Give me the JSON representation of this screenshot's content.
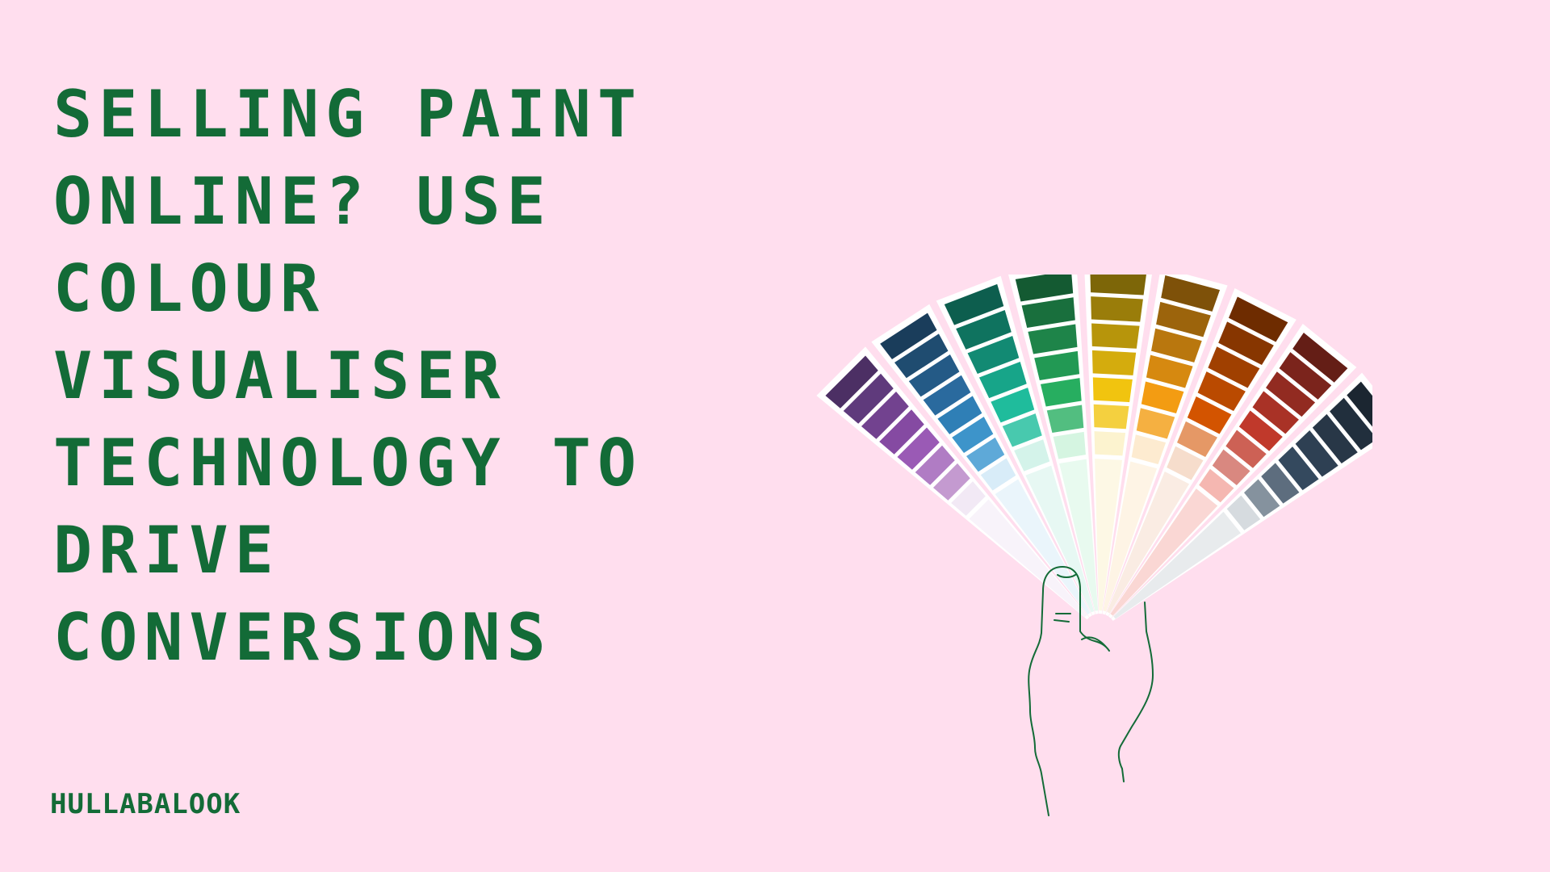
{
  "colors": {
    "background": "#ffdeee",
    "text": "#136b37",
    "card_border": "#ffffff",
    "hand_line": "#136b37",
    "hand_fill": "#ffdeee"
  },
  "headline": {
    "lines": [
      "SELLING PAINT",
      "ONLINE? USE",
      "COLOUR",
      "VISUALISER",
      "TECHNOLOGY TO",
      "DRIVE",
      "CONVERSIONS"
    ]
  },
  "brand": {
    "name": "HULLABALOOK"
  },
  "swatch_fan": {
    "icon": "paint-swatch-fan-icon",
    "cards": [
      [
        "#f2e9f5",
        "#c49ad0",
        "#b07cc4",
        "#9a5ab5",
        "#854aa2",
        "#72428f",
        "#5f3a7c",
        "#4c2f64"
      ],
      [
        "#d8ecf8",
        "#5ea9d8",
        "#3d94ca",
        "#2f7fb6",
        "#2a6a9e",
        "#245a86",
        "#1f4c70",
        "#1a3d5b"
      ],
      [
        "#d4f3ea",
        "#48c9ae",
        "#1fbc9c",
        "#17a589",
        "#128a73",
        "#0f735f",
        "#0d5e4e"
      ],
      [
        "#d5f5e1",
        "#52be80",
        "#27ae60",
        "#229954",
        "#1e8449",
        "#196f3d",
        "#145a32"
      ],
      [
        "#fcf3cf",
        "#f4d03f",
        "#f1c40f",
        "#d4ac0d",
        "#b7950b",
        "#9a7d0a",
        "#7d6608"
      ],
      [
        "#fdebd0",
        "#f5b041",
        "#f39c12",
        "#d68910",
        "#b9770e",
        "#9c640c",
        "#7e5109"
      ],
      [
        "#f6ddcc",
        "#e59866",
        "#d35400",
        "#ba4a00",
        "#a04000",
        "#873600",
        "#6e2c00"
      ],
      [
        "#f5b7b1",
        "#d98880",
        "#cd6155",
        "#c0392b",
        "#a93226",
        "#922b21",
        "#7b241c",
        "#641e16"
      ],
      [
        "#d6dbdf",
        "#85929e",
        "#5d6d7e",
        "#34495e",
        "#2e4053",
        "#283747",
        "#212f3d",
        "#1b2631"
      ]
    ]
  }
}
